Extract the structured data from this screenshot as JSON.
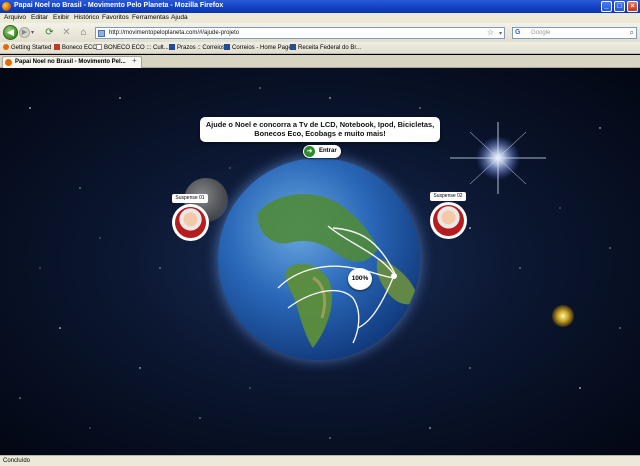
{
  "window": {
    "title": "Papai Noel no Brasil - Movimento Pelo Planeta - Mozilla Firefox"
  },
  "menu": [
    "Arquivo",
    "Editar",
    "Exibir",
    "Histórico",
    "Favoritos",
    "Ferramentas",
    "Ajuda"
  ],
  "nav": {
    "url": "http://movimentopeloplaneta.com/#/ajude-projeto",
    "search_placeholder": "Google"
  },
  "bookmarks": [
    "Getting Started",
    "Boneco ECO",
    "BONECO ECO ::: Cult...",
    "Prazos :: Correios",
    "Correios - Home Page",
    "Receita Federal do Br..."
  ],
  "tab": {
    "label": "Papai Noel no Brasil - Movimento Pel..."
  },
  "page": {
    "headline_line1": "Ajude o Noel e concorra a Tv de LCD, Notebook, Ipod, Bicicletas,",
    "headline_line2": "Bonecos Eco, Ecobags e muito mais!",
    "enter_label": "Entrar",
    "suspect_left": "Suspense 01",
    "suspect_right": "Suspense 02",
    "progress_label": "100%"
  },
  "status": {
    "text": "Concluído"
  }
}
